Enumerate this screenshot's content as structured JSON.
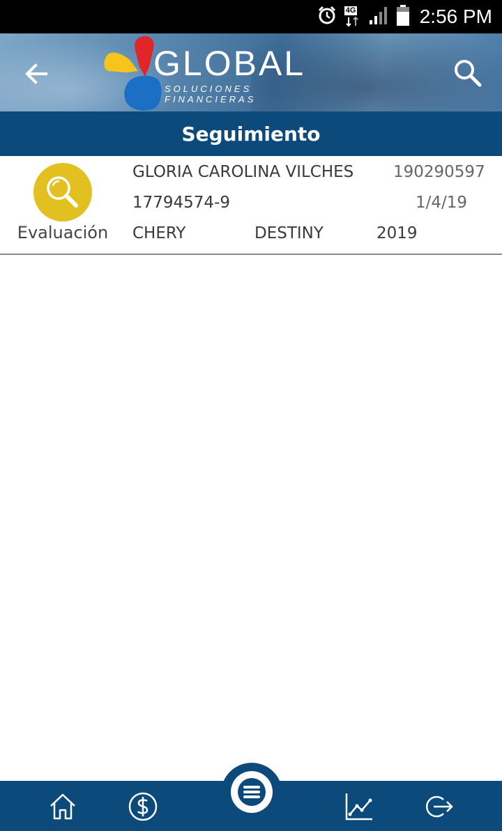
{
  "status_bar": {
    "time": "2:56 PM",
    "network": "4G",
    "icons": [
      "alarm-icon",
      "network-4g-icon",
      "signal-icon",
      "battery-icon"
    ]
  },
  "header": {
    "logo": {
      "word": "GLOBAL",
      "tagline": "SOLUCIONES FINANCIERAS"
    },
    "back_icon": "arrow-left-icon",
    "search_icon": "search-icon"
  },
  "page": {
    "title": "Seguimiento"
  },
  "record": {
    "status_label": "Evaluación",
    "status_icon": "magnifier-icon",
    "name": "GLORIA CAROLINA VILCHES",
    "number": "190290597",
    "id": "17794574-9",
    "date": "1/4/19",
    "brand": "CHERY",
    "model": "DESTINY",
    "year": "2019"
  },
  "bottom_nav": {
    "items": [
      "home-icon",
      "dollar-icon",
      "menu-icon",
      "chart-icon",
      "logout-icon"
    ]
  },
  "colors": {
    "primary": "#0c4a7c",
    "status_yellow": "#e2c01f",
    "logo_red": "#e1262a",
    "logo_yellow": "#f5c51c",
    "logo_blue": "#1b6fc4"
  }
}
